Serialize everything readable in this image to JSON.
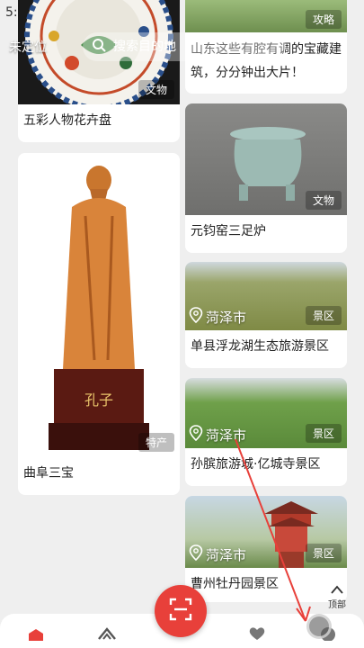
{
  "status": {
    "time": "5:"
  },
  "header": {
    "location_label": "未定位",
    "search_placeholder": "搜索目的地"
  },
  "left_column": [
    {
      "title": "五彩人物花卉盘",
      "tag": "文物"
    },
    {
      "title": "曲阜三宝",
      "tag": "特产",
      "figure_plaque": "孔子"
    }
  ],
  "right_column": [
    {
      "title": "山东这些有腔有调的宝藏建筑，分分钟出大片！",
      "tag": "攻略"
    },
    {
      "title": "元钧窑三足炉",
      "tag": "文物"
    },
    {
      "title": "单县浮龙湖生态旅游景区",
      "tag": "景区",
      "location": "菏泽市"
    },
    {
      "title": "孙膑旅游城·亿城寺景区",
      "tag": "景区",
      "location": "菏泽市"
    },
    {
      "title": "曹州牡丹园景区",
      "tag": "景区",
      "location": "菏泽市"
    }
  ],
  "back_to_top": {
    "label": "顶部"
  },
  "bottom_nav": {
    "icons": [
      "home-icon",
      "discover-icon",
      "scan-icon",
      "favorites-icon",
      "profile-icon"
    ]
  },
  "colors": {
    "accent": "#e8403a",
    "background": "#efefef"
  }
}
